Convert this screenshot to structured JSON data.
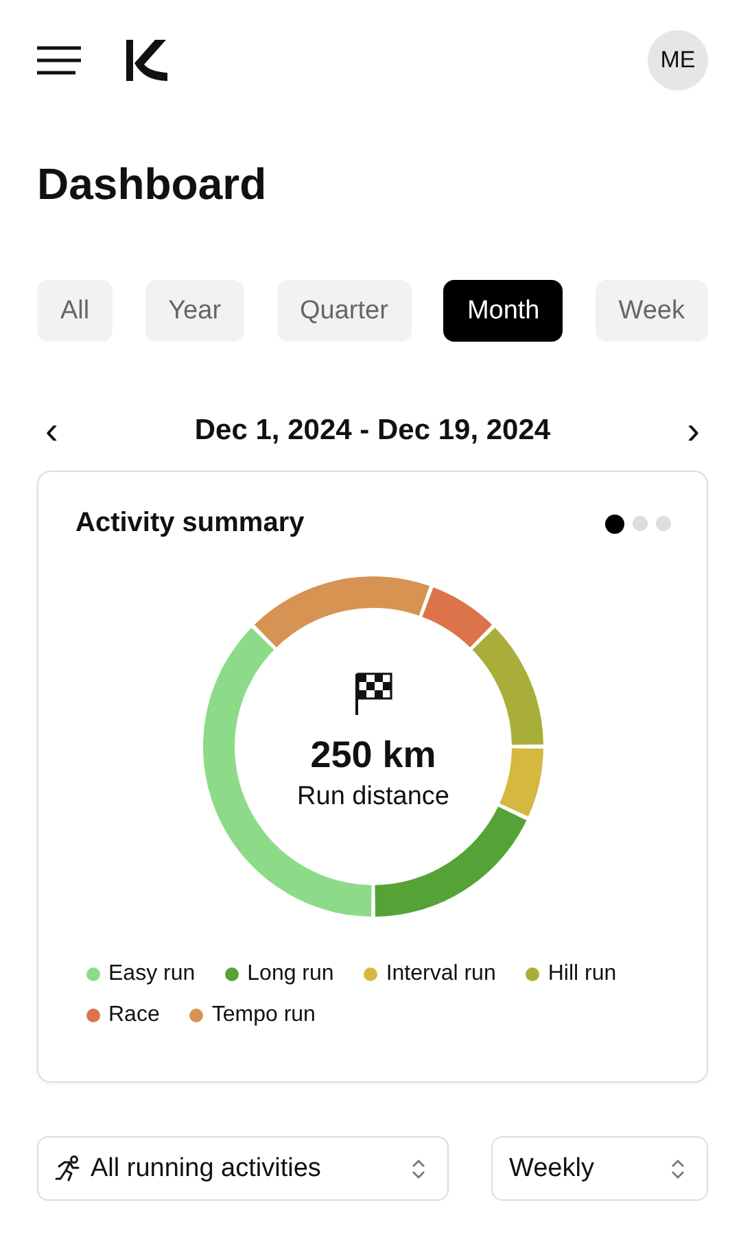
{
  "header": {
    "avatar": "ME"
  },
  "title": "Dashboard",
  "tabs": [
    {
      "label": "All",
      "selected": false
    },
    {
      "label": "Year",
      "selected": false
    },
    {
      "label": "Quarter",
      "selected": false
    },
    {
      "label": "Month",
      "selected": true
    },
    {
      "label": "Week",
      "selected": false
    }
  ],
  "date_range": {
    "prev": "‹",
    "label": "Dec 1, 2024 - Dec 19, 2024",
    "next": "›"
  },
  "card": {
    "title": "Activity summary",
    "pager": [
      {
        "selected": true
      },
      {
        "selected": false
      },
      {
        "selected": false
      }
    ],
    "total": "250 km",
    "total_label": "Run distance",
    "legend": [
      {
        "label": "Easy run",
        "color": "#8ddb88"
      },
      {
        "label": "Long run",
        "color": "#55a337"
      },
      {
        "label": "Interval run",
        "color": "#d4b840"
      },
      {
        "label": "Hill run",
        "color": "#a8ae38"
      },
      {
        "label": "Race",
        "color": "#dc734a"
      },
      {
        "label": "Tempo run",
        "color": "#d69352"
      }
    ]
  },
  "filters": [
    {
      "value": "All running activities",
      "kind": "activity"
    },
    {
      "value": "Weekly",
      "kind": "plain"
    }
  ]
}
